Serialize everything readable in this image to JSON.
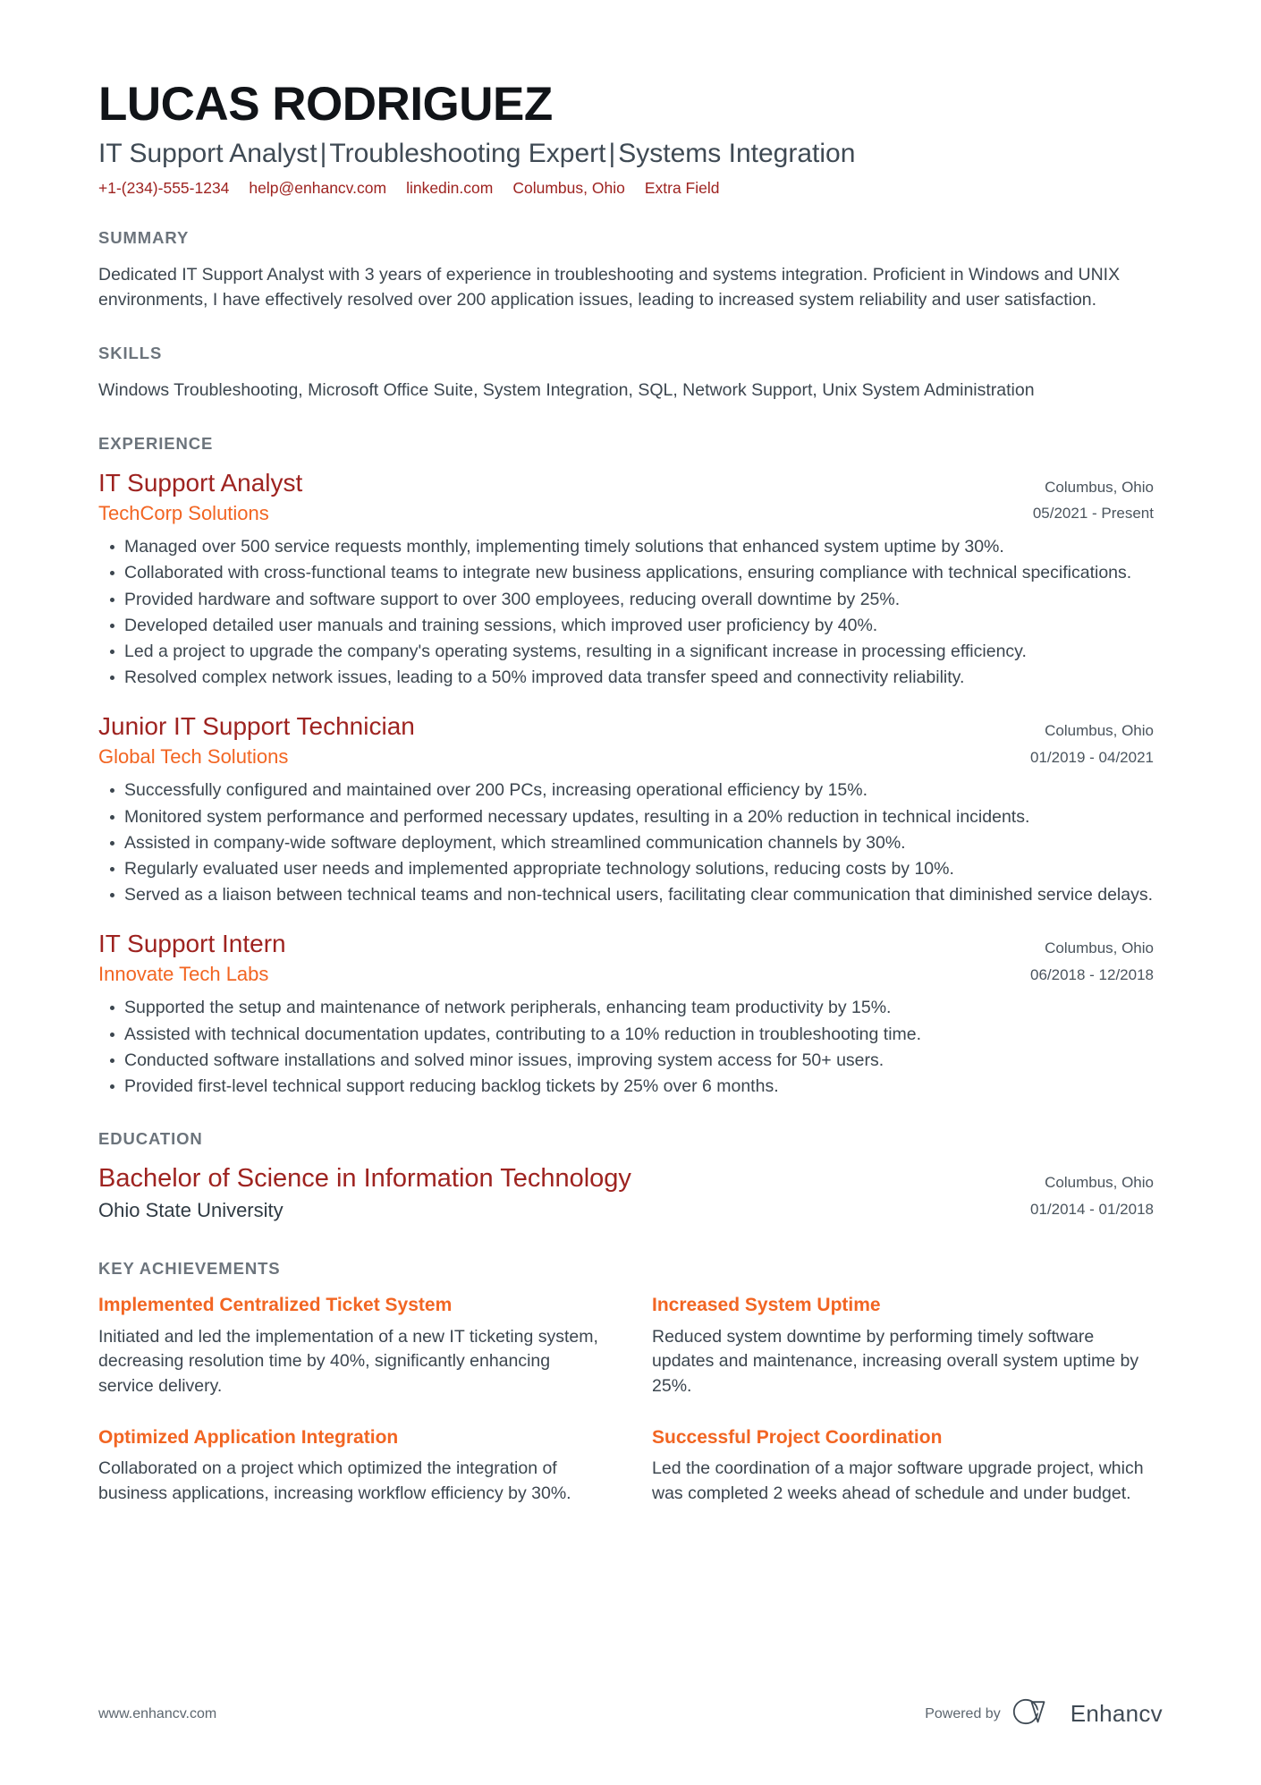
{
  "colors": {
    "name": "#111418",
    "headline": "#3f4a54",
    "accent_red": "#9e2320",
    "accent_orange": "#f26522",
    "section_title": "#6c747c",
    "body": "#3c464f",
    "page_bg": "#ffffff"
  },
  "header": {
    "name": "LUCAS RODRIGUEZ",
    "headline_parts": [
      "IT Support Analyst",
      "Troubleshooting Expert",
      "Systems Integration"
    ],
    "headline_separator": "|",
    "contacts": [
      {
        "name": "phone",
        "text": "+1-(234)-555-1234"
      },
      {
        "name": "email",
        "text": "help@enhancv.com"
      },
      {
        "name": "linkedin",
        "text": "linkedin.com"
      },
      {
        "name": "location",
        "text": "Columbus, Ohio"
      },
      {
        "name": "extra",
        "text": "Extra Field"
      }
    ]
  },
  "summary": {
    "title": "SUMMARY",
    "text": "Dedicated IT Support Analyst with 3 years of experience in troubleshooting and systems integration. Proficient in Windows and UNIX environments, I have effectively resolved over 200 application issues, leading to increased system reliability and user satisfaction."
  },
  "skills": {
    "title": "SKILLS",
    "text": "Windows Troubleshooting, Microsoft Office Suite, System Integration, SQL, Network Support, Unix System Administration"
  },
  "experience": {
    "title": "EXPERIENCE",
    "entries": [
      {
        "job_title": "IT Support Analyst",
        "company": "TechCorp Solutions",
        "location": "Columbus, Ohio",
        "dates": "05/2021 - Present",
        "bullets": [
          "Managed over 500 service requests monthly, implementing timely solutions that enhanced system uptime by 30%.",
          "Collaborated with cross-functional teams to integrate new business applications, ensuring compliance with technical specifications.",
          "Provided hardware and software support to over 300 employees, reducing overall downtime by 25%.",
          "Developed detailed user manuals and training sessions, which improved user proficiency by 40%.",
          "Led a project to upgrade the company's operating systems, resulting in a significant increase in processing efficiency.",
          "Resolved complex network issues, leading to a 50% improved data transfer speed and connectivity reliability."
        ]
      },
      {
        "job_title": "Junior IT Support Technician",
        "company": "Global Tech Solutions",
        "location": "Columbus, Ohio",
        "dates": "01/2019 - 04/2021",
        "bullets": [
          "Successfully configured and maintained over 200 PCs, increasing operational efficiency by 15%.",
          "Monitored system performance and performed necessary updates, resulting in a 20% reduction in technical incidents.",
          "Assisted in company-wide software deployment, which streamlined communication channels by 30%.",
          "Regularly evaluated user needs and implemented appropriate technology solutions, reducing costs by 10%.",
          "Served as a liaison between technical teams and non-technical users, facilitating clear communication that diminished service delays."
        ]
      },
      {
        "job_title": "IT Support Intern",
        "company": "Innovate Tech Labs",
        "location": "Columbus, Ohio",
        "dates": "06/2018 - 12/2018",
        "bullets": [
          "Supported the setup and maintenance of network peripherals, enhancing team productivity by 15%.",
          "Assisted with technical documentation updates, contributing to a 10% reduction in troubleshooting time.",
          "Conducted software installations and solved minor issues, improving system access for 50+ users.",
          "Provided first-level technical support reducing backlog tickets by 25% over 6 months."
        ]
      }
    ]
  },
  "education": {
    "title": "EDUCATION",
    "entries": [
      {
        "degree": "Bachelor of Science in Information Technology",
        "school": "Ohio State University",
        "location": "Columbus, Ohio",
        "dates": "01/2014 - 01/2018"
      }
    ]
  },
  "achievements": {
    "title": "KEY ACHIEVEMENTS",
    "items": [
      {
        "title": "Implemented Centralized Ticket System",
        "description": "Initiated and led the implementation of a new IT ticketing system, decreasing resolution time by 40%, significantly enhancing service delivery."
      },
      {
        "title": "Increased System Uptime",
        "description": "Reduced system downtime by performing timely software updates and maintenance, increasing overall system uptime by 25%."
      },
      {
        "title": "Optimized Application Integration",
        "description": "Collaborated on a project which optimized the integration of business applications, increasing workflow efficiency by 30%."
      },
      {
        "title": "Successful Project Coordination",
        "description": "Led the coordination of a major software upgrade project, which was completed 2 weeks ahead of schedule and under budget."
      }
    ]
  },
  "footer": {
    "url": "www.enhancv.com",
    "powered_by": "Powered by",
    "brand": "Enhancv"
  }
}
